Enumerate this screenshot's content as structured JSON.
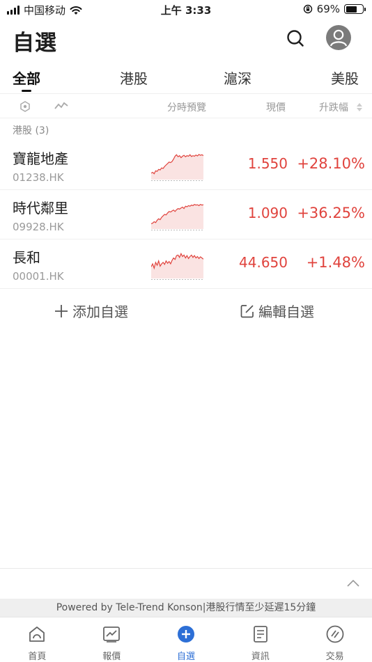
{
  "status_bar": {
    "carrier": "中国移动",
    "time": "上午 3:33",
    "battery": "69%",
    "battery_level": 0.69
  },
  "header": {
    "title": "自選"
  },
  "tabs": [
    {
      "label": "全部",
      "active": true
    },
    {
      "label": "港股",
      "active": false
    },
    {
      "label": "滬深",
      "active": false
    },
    {
      "label": "美股",
      "active": false
    }
  ],
  "columns": {
    "chart": "分時預覽",
    "price": "現價",
    "change": "升跌幅"
  },
  "group": {
    "label": "港股 (3)"
  },
  "stocks": [
    {
      "name": "寶龍地產",
      "code": "01238.HK",
      "price": "1.550",
      "change": "+28.10%",
      "spark": [
        0.22,
        0.25,
        0.2,
        0.3,
        0.28,
        0.35,
        0.33,
        0.4,
        0.38,
        0.45,
        0.5,
        0.55,
        0.6,
        0.58,
        0.62,
        0.7,
        0.8,
        0.85,
        0.78,
        0.82,
        0.75,
        0.8,
        0.83,
        0.78,
        0.82,
        0.8,
        0.85,
        0.79,
        0.82,
        0.8,
        0.84,
        0.81,
        0.86,
        0.83,
        0.85,
        0.82
      ]
    },
    {
      "name": "時代鄰里",
      "code": "09928.HK",
      "price": "1.090",
      "change": "+36.25%",
      "spark": [
        0.18,
        0.2,
        0.25,
        0.22,
        0.3,
        0.35,
        0.32,
        0.4,
        0.45,
        0.5,
        0.48,
        0.55,
        0.6,
        0.58,
        0.62,
        0.65,
        0.6,
        0.66,
        0.7,
        0.68,
        0.72,
        0.75,
        0.7,
        0.78,
        0.76,
        0.8,
        0.78,
        0.82,
        0.8,
        0.84,
        0.82,
        0.83,
        0.8,
        0.84,
        0.82,
        0.83
      ]
    },
    {
      "name": "長和",
      "code": "00001.HK",
      "price": "44.650",
      "change": "+1.48%",
      "spark": [
        0.4,
        0.5,
        0.35,
        0.55,
        0.45,
        0.6,
        0.42,
        0.5,
        0.55,
        0.48,
        0.6,
        0.52,
        0.58,
        0.5,
        0.62,
        0.7,
        0.65,
        0.78,
        0.8,
        0.72,
        0.85,
        0.75,
        0.8,
        0.7,
        0.78,
        0.68,
        0.75,
        0.8,
        0.72,
        0.78,
        0.7,
        0.75,
        0.68,
        0.74,
        0.7,
        0.66
      ]
    }
  ],
  "actions": {
    "add": "添加自選",
    "edit": "編輯自選"
  },
  "footer": {
    "powered": "Powered by Tele-Trend Konson|港股行情至少延遲15分鐘"
  },
  "tabbar": [
    {
      "label": "首頁",
      "icon": "home-icon",
      "active": false
    },
    {
      "label": "報價",
      "icon": "chart-icon",
      "active": false
    },
    {
      "label": "自選",
      "icon": "add-circle-icon",
      "active": true
    },
    {
      "label": "資訊",
      "icon": "news-icon",
      "active": false
    },
    {
      "label": "交易",
      "icon": "trade-icon",
      "active": false
    }
  ],
  "colors": {
    "up": "#e0433d",
    "accent": "#2d6fd6",
    "text": "#1f1f1f",
    "muted": "#999999"
  }
}
